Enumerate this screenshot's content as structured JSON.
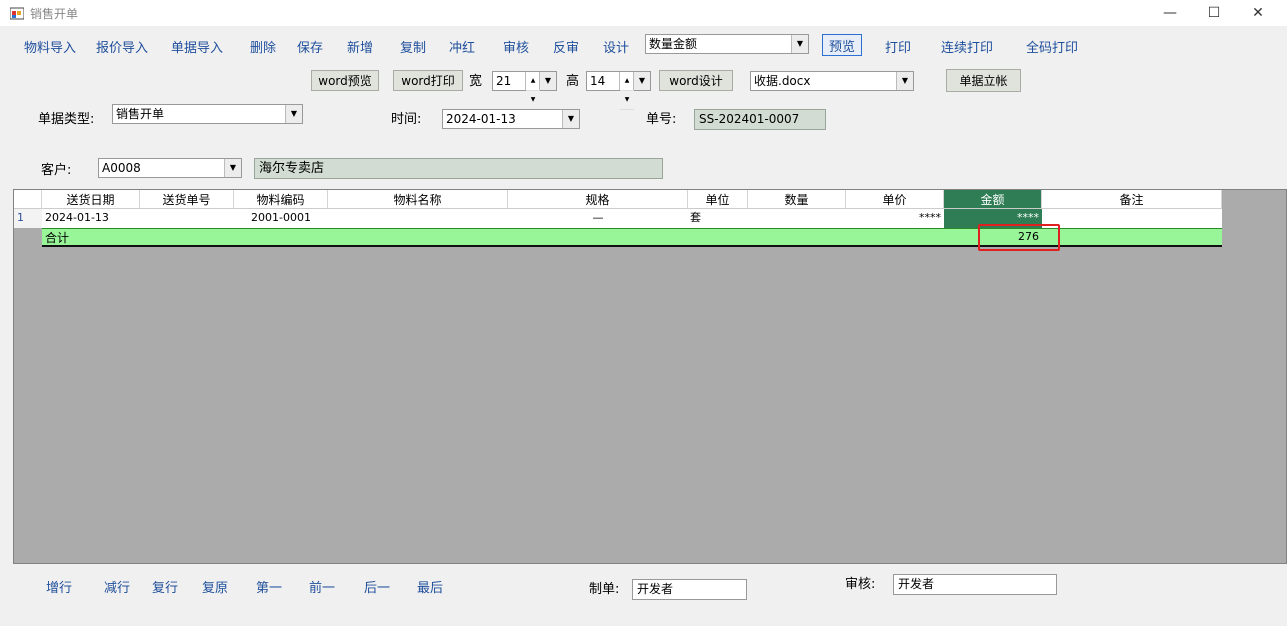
{
  "window": {
    "title": "销售开单",
    "minimize": "—",
    "maximize": "☐",
    "close": "✕"
  },
  "toolbar": {
    "items": [
      "物料导入",
      "报价导入",
      "单据导入",
      "删除",
      "保存",
      "新增",
      "复制",
      "冲红",
      "审核",
      "反审",
      "设计"
    ],
    "amount_mode": "数量金额",
    "preview": "预览",
    "print": "打印",
    "continuous_print": "连续打印",
    "full_code_print": "全码打印"
  },
  "word": {
    "preview": "word预览",
    "print": "word打印",
    "width_label": "宽",
    "width_value": "21",
    "height_label": "高",
    "height_value": "14",
    "design": "word设计",
    "template": "收据.docx",
    "post_button": "单据立帐"
  },
  "form": {
    "doc_type_label": "单据类型:",
    "doc_type_value": "销售开单",
    "time_label": "时间:",
    "time_value": "2024-01-13",
    "doc_no_label": "单号:",
    "doc_no_value": "SS-202401-0007",
    "customer_label": "客户:",
    "customer_code": "A0008",
    "customer_name": "海尔专卖店"
  },
  "grid": {
    "columns": [
      "送货日期",
      "送货单号",
      "物料编码",
      "物料名称",
      "规格",
      "单位",
      "数量",
      "单价",
      "金额",
      "备注"
    ],
    "rows": [
      {
        "index": "1",
        "date": "2024-01-13",
        "delivery_no": "",
        "code": "2001-0001",
        "name": "",
        "spec": "—",
        "unit": "套",
        "qty": "",
        "price": "****",
        "amount": "****",
        "note": ""
      }
    ],
    "total_label": "合计",
    "total_amount": "276",
    "selected_color": "#2e7d55",
    "total_row_color": "#98f598",
    "highlight_color": "#e02020"
  },
  "bottom": {
    "nav": [
      "增行",
      "减行",
      "复行",
      "复原",
      "第一",
      "前一",
      "后一",
      "最后"
    ],
    "maker_label": "制单:",
    "maker_value": "开发者",
    "auditor_label": "审核:",
    "auditor_value": "开发者"
  }
}
